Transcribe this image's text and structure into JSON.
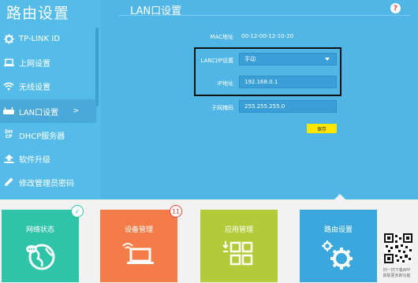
{
  "sidebar": {
    "title": "路由设置",
    "items": [
      {
        "label": "TP-LINK ID",
        "icon": "gear-icon"
      },
      {
        "label": "上网设置",
        "icon": "laptop-icon"
      },
      {
        "label": "无线设置",
        "icon": "wifi-icon"
      },
      {
        "label": "LAN口设置",
        "icon": "router-icon",
        "active": true,
        "arrow": ">"
      },
      {
        "label": "DHCP服务器",
        "icon": "dhcp-icon",
        "icon_text": "DH\nCP"
      },
      {
        "label": "软件升级",
        "icon": "upload-icon"
      },
      {
        "label": "修改管理员密码",
        "icon": "pencil-icon"
      }
    ]
  },
  "main": {
    "title": "LAN口设置",
    "mac_label": "MAC地址",
    "mac_value": "00-12-00-12-10-20",
    "lan_ip_label": "LAN口IP设置",
    "lan_ip_value": "手动",
    "ip_label": "IP地址",
    "ip_value": "192.168.0.1",
    "mask_label": "子网掩码",
    "mask_value": "255.255.255.0",
    "save_label": "保存"
  },
  "tiles": [
    {
      "label": "网络状态",
      "color": "#2fc4a8",
      "badge": "✓"
    },
    {
      "label": "设备管理",
      "color": "#f47c48",
      "badge": "11"
    },
    {
      "label": "应用管理",
      "color": "#b3cb38"
    },
    {
      "label": "路由设置",
      "color": "#3aa8dc"
    }
  ],
  "qr_caption": "扫一扫下载APP\n获取更多新功能",
  "colors": {
    "accent": "#4fb6e6",
    "save": "#ffe600",
    "badge_red": "#e8443a"
  }
}
